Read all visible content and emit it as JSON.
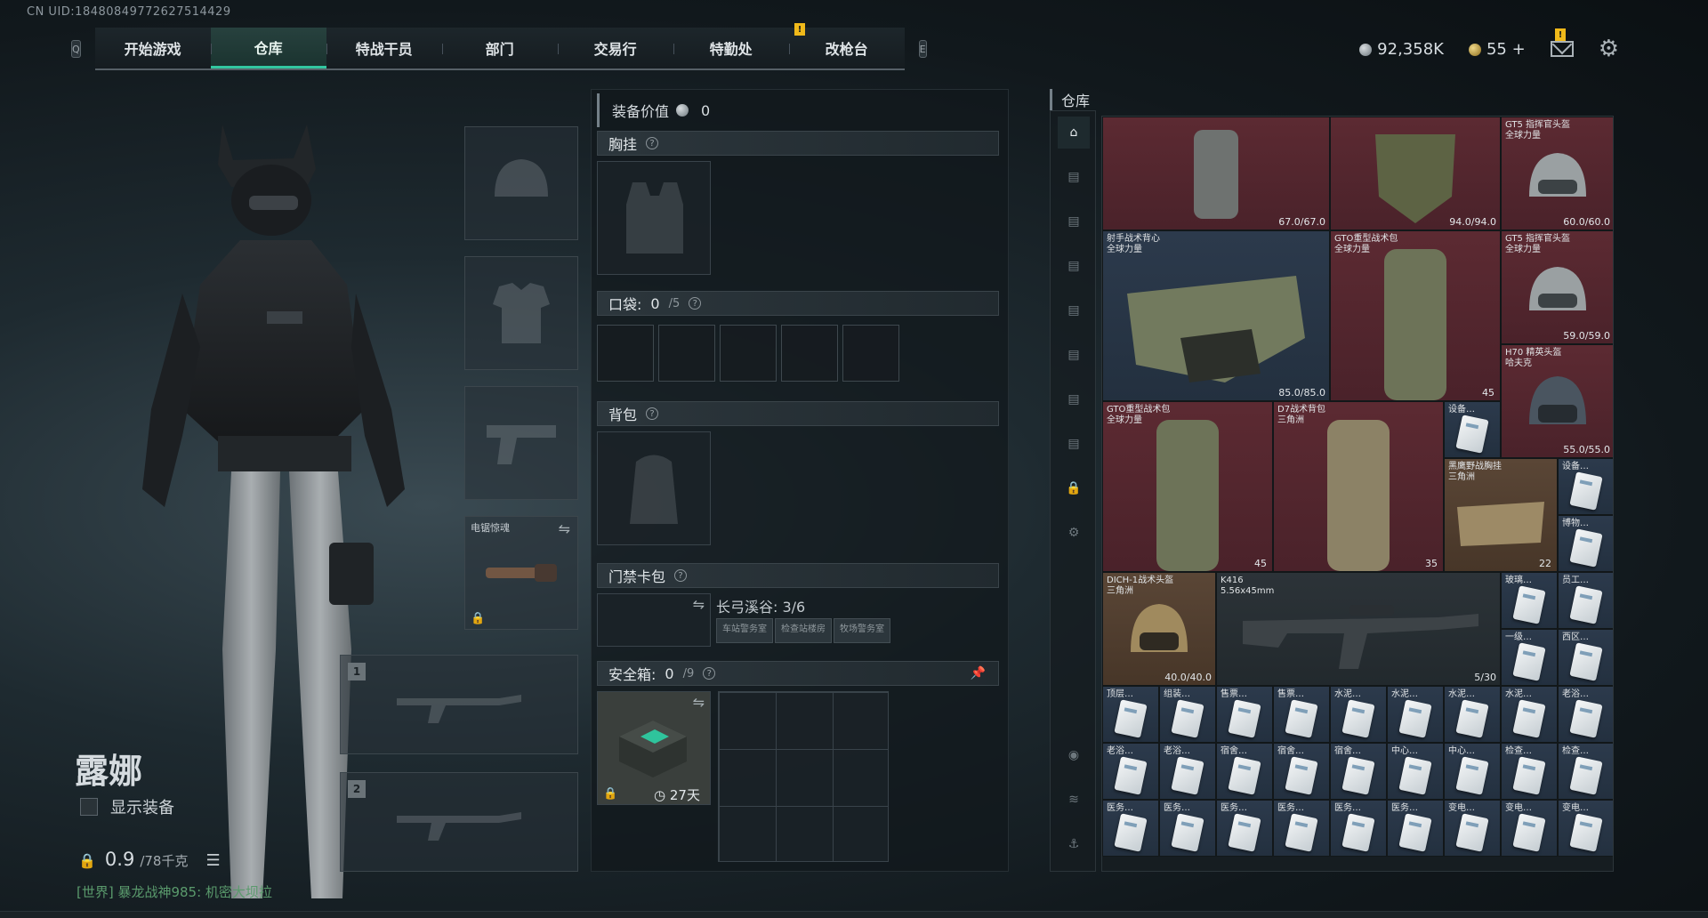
{
  "uid": "CN UID:18480849772627514429",
  "nav": {
    "left_key": "Q",
    "right_key": "E",
    "tabs": [
      "开始游戏",
      "仓库",
      "特战干员",
      "部门",
      "交易行",
      "特勤处",
      "改枪台"
    ],
    "active_tab": "仓库",
    "alert": "!"
  },
  "currency": {
    "silver": "92,358K",
    "gold": "55 +"
  },
  "mail_alert": "!",
  "character": {
    "name": "露娜",
    "show_gear": "显示装备",
    "weight_value": "0.9",
    "weight_limit": "/78千克"
  },
  "chat": "[世界] 暴龙战神985: 机密大坝拉",
  "loadout": {
    "melee_label": "电锯惊魂",
    "weapon_slots": [
      "1",
      "2"
    ]
  },
  "equipment": {
    "value_label": "装备价值",
    "value": "0",
    "chest_rig": "胸挂",
    "pockets_label": "口袋:",
    "pockets_used": "0",
    "pockets_cap": "/5",
    "backpack": "背包",
    "keycard": "门禁卡包",
    "keycard_map": "长弓溪谷: 3/6",
    "keycard_tags": [
      "车站警务室",
      "检查站楼房",
      "牧场警务室"
    ],
    "safebox_label": "安全箱:",
    "safebox_used": "0",
    "safebox_cap": "/9",
    "safebox_timer": "27天",
    "help": "?"
  },
  "warehouse": {
    "title": "仓库",
    "items": [
      {
        "name": "",
        "dur": "67.0/67.0",
        "color": "red"
      },
      {
        "name": "",
        "dur": "94.0/94.0",
        "color": "red"
      },
      {
        "name": "GT5 指挥官头盔\n全球力量",
        "dur": "60.0/60.0",
        "color": "red"
      },
      {
        "name": "射手战术背心\n全球力量",
        "dur": "85.0/85.0",
        "color": "blue"
      },
      {
        "name": "GTO重型战术包\n全球力量",
        "count": "45",
        "color": "red"
      },
      {
        "name": "GT5 指挥官头盔\n全球力量",
        "dur": "59.0/59.0",
        "color": "red"
      },
      {
        "name": "H70 精英头盔\n哈夫克",
        "dur": "55.0/55.0",
        "color": "red"
      },
      {
        "name": "GTO重型战术包\n全球力量",
        "count": "45",
        "color": "red"
      },
      {
        "name": "D7战术背包\n三角洲",
        "count": "35",
        "color": "red"
      },
      {
        "name": "设备…",
        "color": "blue"
      },
      {
        "name": "黑鹰野战胸挂\n三角洲",
        "count": "22",
        "color": "brown"
      },
      {
        "name": "设备…",
        "color": "blue"
      },
      {
        "name": "博物…",
        "color": "blue"
      },
      {
        "name": "DICH-1战术头盔\n三角洲",
        "dur": "40.0/40.0",
        "color": "brown"
      },
      {
        "name": "K416\n5.56x45mm",
        "dur": "5/30",
        "color": "dark"
      },
      {
        "name": "玻璃…",
        "color": "blue"
      },
      {
        "name": "员工…",
        "color": "blue"
      },
      {
        "name": "一级…",
        "color": "blue"
      },
      {
        "name": "西区…",
        "color": "blue"
      }
    ],
    "card_rows": [
      [
        "顶层…",
        "组装…",
        "售票…",
        "售票…",
        "水泥…",
        "水泥…",
        "水泥…",
        "水泥…",
        "老浴…"
      ],
      [
        "老浴…",
        "老浴…",
        "宿舍…",
        "宿舍…",
        "宿舍…",
        "中心…",
        "中心…",
        "检查…",
        "检查…"
      ],
      [
        "医务…",
        "医务…",
        "医务…",
        "医务…",
        "医务…",
        "医务…",
        "变电…",
        "变电…",
        "变电…"
      ]
    ],
    "side_icons": [
      "warehouse-home-icon",
      "storage-page-icon",
      "lock-icon",
      "settings-icon",
      "profile-icon",
      "layers-icon",
      "anchor-icon"
    ]
  },
  "colors": {
    "accent": "#32c7a0",
    "red_item": "#5c2a32",
    "blue_item": "#2c3a4c",
    "brown_item": "#5a4636"
  }
}
